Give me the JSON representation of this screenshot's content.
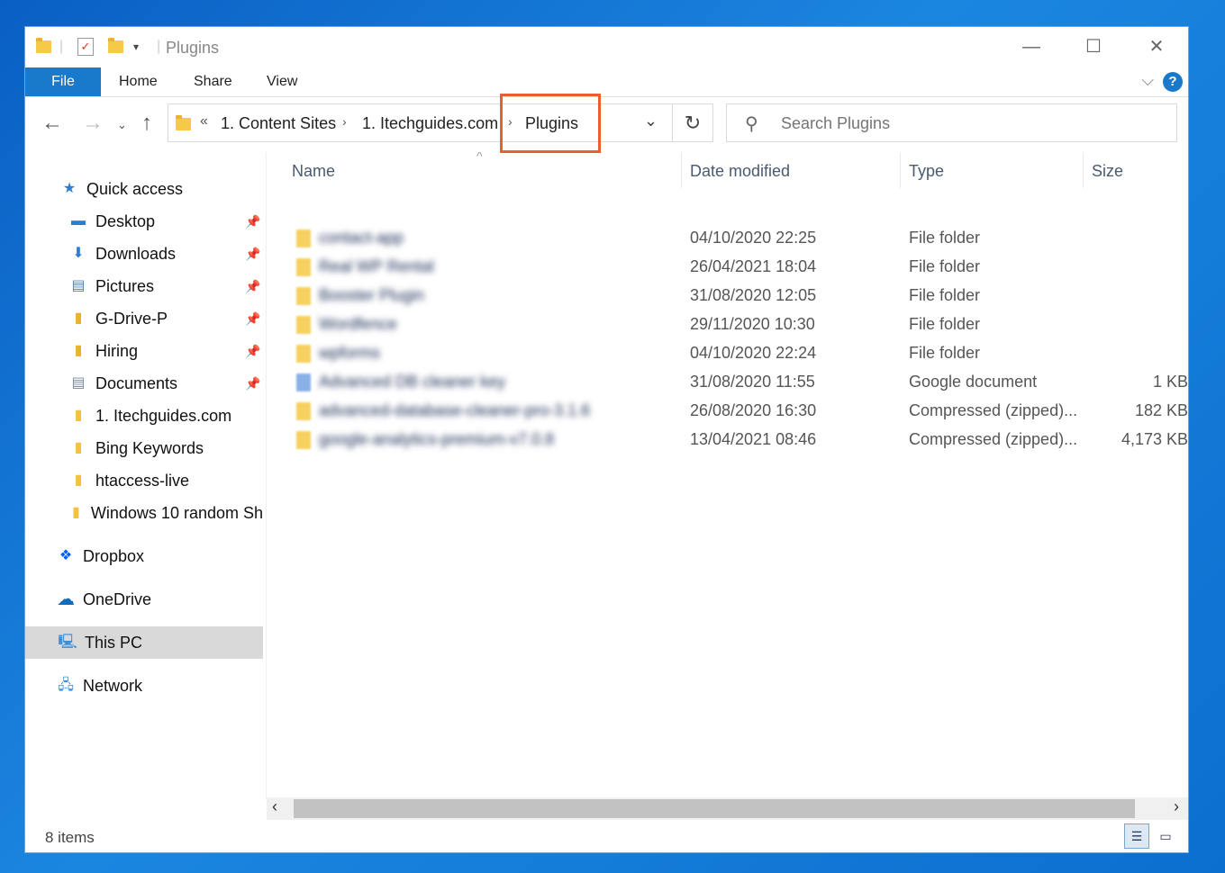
{
  "window": {
    "title": "Plugins",
    "minimize_glyph": "—",
    "maximize_glyph": "☐",
    "close_glyph": "✕"
  },
  "ribbon": {
    "file": "File",
    "tabs": [
      "Home",
      "Share",
      "View"
    ],
    "help": "?"
  },
  "address": {
    "overflow": "«",
    "crumbs": [
      "1. Content Sites",
      "1. Itechguides.com",
      "Plugins"
    ],
    "separator": "›"
  },
  "search": {
    "placeholder": "Search Plugins"
  },
  "sidebar": {
    "quick_access": "Quick access",
    "items": [
      {
        "label": "Desktop",
        "icon": "desktop-icon",
        "pinned": true
      },
      {
        "label": "Downloads",
        "icon": "download-icon",
        "pinned": true
      },
      {
        "label": "Pictures",
        "icon": "pictures-icon",
        "pinned": true
      },
      {
        "label": "G-Drive-P",
        "icon": "folder-user-icon",
        "pinned": true
      },
      {
        "label": "Hiring",
        "icon": "folder-user-icon",
        "pinned": true
      },
      {
        "label": "Documents",
        "icon": "documents-icon",
        "pinned": true
      },
      {
        "label": "1. Itechguides.com",
        "icon": "folder-icon",
        "pinned": false
      },
      {
        "label": "Bing Keywords",
        "icon": "folder-icon",
        "pinned": false
      },
      {
        "label": "htaccess-live",
        "icon": "folder-icon",
        "pinned": false
      },
      {
        "label": "Windows 10 random Sh",
        "icon": "folder-icon",
        "pinned": false
      }
    ],
    "dropbox": "Dropbox",
    "onedrive": "OneDrive",
    "thispc": "This PC",
    "network": "Network"
  },
  "columns": {
    "name": "Name",
    "date": "Date modified",
    "type": "Type",
    "size": "Size"
  },
  "files": [
    {
      "name": "contact-app",
      "date": "04/10/2020 22:25",
      "type": "File folder",
      "size": "",
      "icon": "folder-icon"
    },
    {
      "name": "Real WP Rental",
      "date": "26/04/2021 18:04",
      "type": "File folder",
      "size": "",
      "icon": "folder-icon"
    },
    {
      "name": "Booster Plugin",
      "date": "31/08/2020 12:05",
      "type": "File folder",
      "size": "",
      "icon": "folder-icon"
    },
    {
      "name": "Wordfence",
      "date": "29/11/2020 10:30",
      "type": "File folder",
      "size": "",
      "icon": "folder-icon"
    },
    {
      "name": "wpforms",
      "date": "04/10/2020 22:24",
      "type": "File folder",
      "size": "",
      "icon": "folder-icon"
    },
    {
      "name": "Advanced DB cleaner key",
      "date": "31/08/2020 11:55",
      "type": "Google document",
      "size": "1 KB",
      "icon": "google-doc-icon"
    },
    {
      "name": "advanced-database-cleaner-pro-3.1.6",
      "date": "26/08/2020 16:30",
      "type": "Compressed (zipped)...",
      "size": "182 KB",
      "icon": "zip-icon"
    },
    {
      "name": "google-analytics-premium-v7.0.8",
      "date": "13/04/2021 08:46",
      "type": "Compressed (zipped)...",
      "size": "4,173 KB",
      "icon": "zip-icon"
    }
  ],
  "status": {
    "items": "8 items"
  }
}
